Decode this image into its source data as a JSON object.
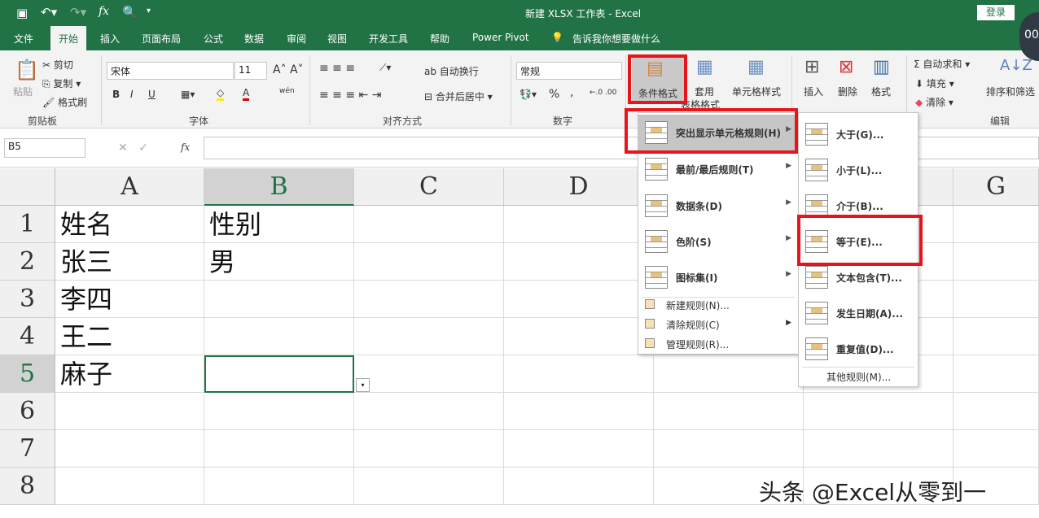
{
  "window": {
    "title": "新建 XLSX 工作表  -  Excel",
    "login": "登录",
    "badge": "00"
  },
  "qat": {
    "save": "save-icon",
    "undo": "undo-icon",
    "redo": "redo-icon",
    "fx": "fx",
    "preview": "print-preview-icon"
  },
  "tabs": [
    "文件",
    "开始",
    "插入",
    "页面布局",
    "公式",
    "数据",
    "审阅",
    "视图",
    "开发工具",
    "帮助",
    "Power Pivot"
  ],
  "tell_me": "告诉我你想要做什么",
  "ribbon": {
    "clipboard": {
      "paste": "粘贴",
      "cut": "剪切",
      "copy": "复制",
      "format_painter": "格式刷",
      "label": "剪贴板"
    },
    "font": {
      "name": "宋体",
      "size": "11",
      "bold": "B",
      "italic": "I",
      "underline": "U",
      "label": "字体",
      "phonetic": "wén"
    },
    "align": {
      "wrap": "自动换行",
      "merge": "合并后居中",
      "label": "对齐方式"
    },
    "number": {
      "format": "常规",
      "percent": "%",
      "comma": ",",
      "label": "数字"
    },
    "styles": {
      "conditional": "条件格式",
      "table1": "套用",
      "table2": "表格格式",
      "cell_styles": "单元格样式"
    },
    "cells": {
      "insert": "插入",
      "delete": "删除",
      "format": "格式"
    },
    "editing": {
      "autosum": "自动求和",
      "fill": "填充",
      "clear": "清除",
      "sort": "排序和筛选",
      "label": "编辑"
    }
  },
  "formula_bar": {
    "name_box": "B5",
    "fx": "fx",
    "value": ""
  },
  "columns": [
    "A",
    "B",
    "C",
    "D",
    "E",
    "F",
    "G"
  ],
  "rows": [
    "1",
    "2",
    "3",
    "4",
    "5",
    "6",
    "7",
    "8"
  ],
  "cells": {
    "A1": "姓名",
    "B1": "性别",
    "A2": "张三",
    "B2": "男",
    "A3": "李四",
    "A4": "王二",
    "A5": "麻子"
  },
  "cf_menu": {
    "items": [
      "突出显示单元格规则(H)",
      "最前/最后规则(T)",
      "数据条(D)",
      "色阶(S)",
      "图标集(I)"
    ],
    "small": [
      "新建规则(N)...",
      "清除规则(C)",
      "管理规则(R)..."
    ]
  },
  "submenu": {
    "items": [
      "大于(G)...",
      "小于(L)...",
      "介于(B)...",
      "等于(E)...",
      "文本包含(T)...",
      "发生日期(A)...",
      "重复值(D)..."
    ],
    "more": "其他规则(M)..."
  },
  "watermark": "头条 @Excel从零到一",
  "colors": {
    "excel_green": "#217346",
    "highlight": "#e8141c"
  }
}
